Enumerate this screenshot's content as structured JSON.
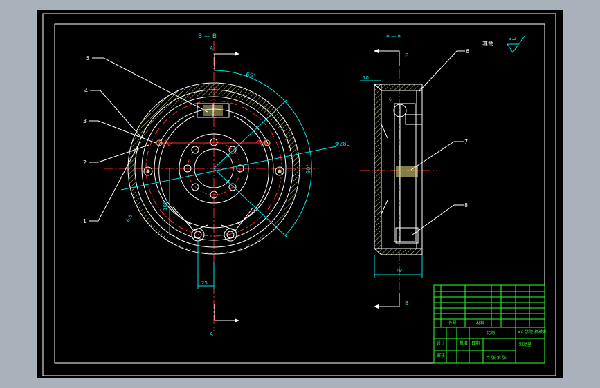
{
  "colors": {
    "frame_bg": "#a9b1bb",
    "paper": "#000000",
    "border": "#ffffff",
    "outline": "#ffffff",
    "center_line": "#ff2a2a",
    "dimension": "#00e5e5",
    "hatch": "#d9d27a",
    "title_block": "#33ff33",
    "callout": "#ffffff"
  },
  "section_labels": {
    "bb_title": "B — B",
    "aa_title": "A — A",
    "cut_a_top": "A",
    "cut_a_bottom": "A",
    "cut_b_top": "B",
    "cut_b_bottom": "B"
  },
  "dimensions": {
    "angle_65": "65°",
    "angle_90": "90°",
    "diameter": "Φ280",
    "d106": "106",
    "d25": "25",
    "d10": "10",
    "d79": "79",
    "d6": "6",
    "d65": "6.5"
  },
  "callouts": [
    "1",
    "2",
    "3",
    "4",
    "5",
    "6",
    "7",
    "8"
  ],
  "surface_note": {
    "text": "其余",
    "roughness": "3.2"
  },
  "title_block": {
    "drawing_title": "制动器",
    "scale_label": "比例",
    "sheet_label": "共 张 第 张",
    "school": "XX 学院 机械系",
    "design": "设计",
    "check": "审核",
    "approve": "批准",
    "date": "日期",
    "quantity_label": "件号",
    "material_label": "材料"
  }
}
